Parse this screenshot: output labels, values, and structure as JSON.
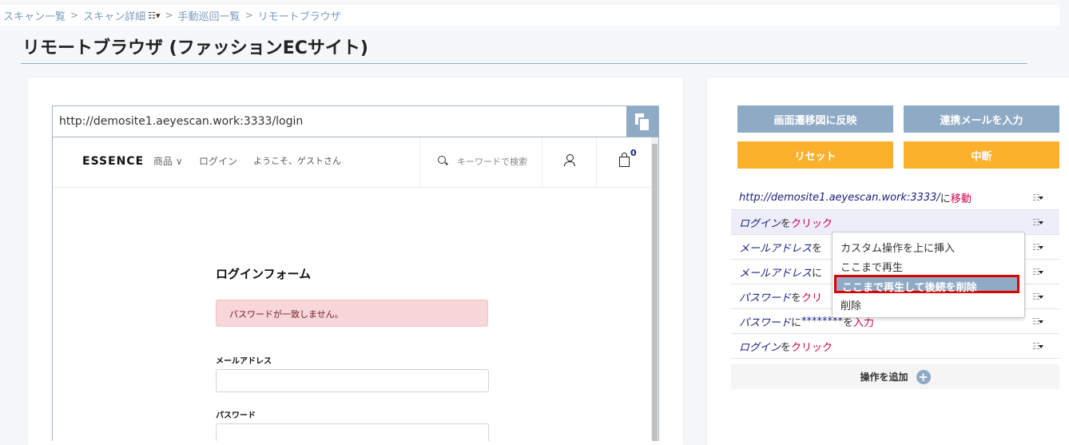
{
  "breadcrumb": {
    "items": [
      "スキャン一覧",
      "スキャン詳細",
      "手動巡回一覧",
      "リモートブラウザ"
    ],
    "separator": ">"
  },
  "page": {
    "title": "リモートブラウザ (ファッションECサイト)"
  },
  "browser": {
    "url": "http://demosite1.aeyescan.work:3333/login",
    "site": {
      "logo": "ESSENCE",
      "nav_product": "商品",
      "nav_product_caret": "∨",
      "nav_login": "ログイン",
      "welcome": "ようこそ、ゲストさん",
      "search_placeholder": "キーワードで検索",
      "cart_count": "0"
    },
    "form": {
      "title": "ログインフォーム",
      "alert": "パスワードが一致しません。",
      "email_label": "メールアドレス",
      "password_label": "パスワード"
    }
  },
  "actions": {
    "reflect": "画面遷移図に反映",
    "mail": "連携メールを入力",
    "reset": "リセット",
    "stop": "中断"
  },
  "steps": [
    {
      "obj": "http://demosite1.aeyescan.work:3333/",
      "pp": "に",
      "val": "",
      "act": "移動"
    },
    {
      "obj": "ログイン",
      "pp": "を",
      "val": "",
      "act": "クリック"
    },
    {
      "obj": "メールアドレス",
      "pp": "を",
      "val": "",
      "act": ""
    },
    {
      "obj": "メールアドレス",
      "pp": "に",
      "val": "",
      "act": ""
    },
    {
      "obj": "パスワード",
      "pp": "を",
      "val": "",
      "act": "クリ"
    },
    {
      "obj": "パスワード",
      "pp": "に",
      "val": "********",
      "pp2": "を",
      "act": "入力"
    },
    {
      "obj": "ログイン",
      "pp": "を",
      "val": "",
      "act": "クリック"
    }
  ],
  "add_operation": "操作を追加",
  "context_menu": {
    "items": [
      "カスタム操作を上に挿入",
      "ここまで再生",
      "ここまで再生して後続を削除",
      "削除"
    ]
  },
  "colors": {
    "steel_blue": "#8faac4",
    "orange": "#fbb12b",
    "highlight_red": "#e00000",
    "action_red": "#d0004c",
    "navy": "#1a237e"
  }
}
